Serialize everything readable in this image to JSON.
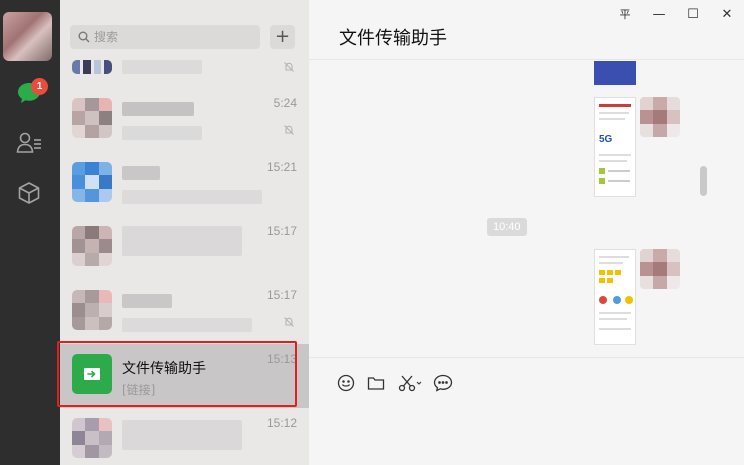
{
  "search": {
    "placeholder": "搜索"
  },
  "rail": {
    "badge_count": "1"
  },
  "list": {
    "add_label": "+",
    "items": [
      {
        "time": "",
        "muted": true
      },
      {
        "time": "5:24",
        "muted": true
      },
      {
        "time": "15:21",
        "muted": false
      },
      {
        "time": "15:17",
        "muted": false
      },
      {
        "time": "15:17",
        "muted": true
      },
      {
        "title": "文件传输助手",
        "subtitle": "[链接]",
        "time": "15:13",
        "selected": true
      },
      {
        "time": "15:12",
        "muted": false
      }
    ]
  },
  "chat": {
    "title": "文件传输助手",
    "timestamp": "10:40",
    "window_controls": {
      "pin": "平",
      "minimize": "—",
      "maximize": "☐",
      "close": "✕"
    }
  },
  "colors": {
    "accent_green": "#2dab4a",
    "badge_red": "#e84d3d",
    "highlight": "#e02020"
  }
}
